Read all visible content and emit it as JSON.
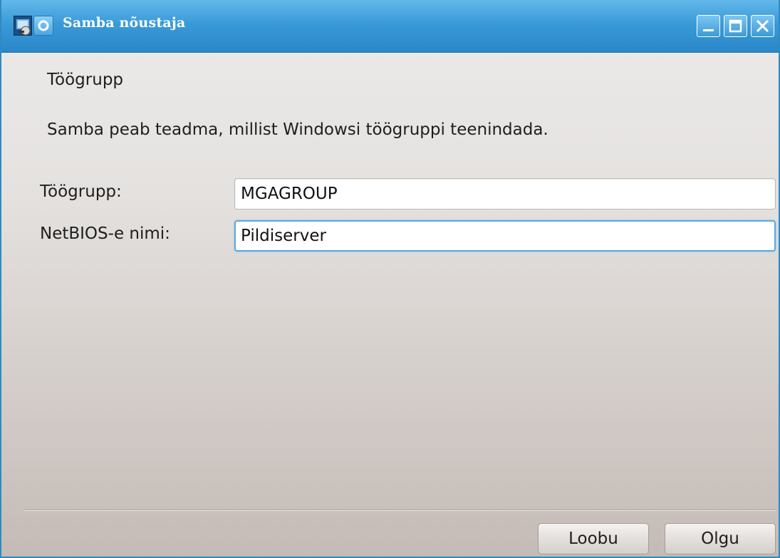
{
  "window": {
    "title": "Samba nõustaja",
    "accent_color": "#3a9ad8",
    "controls": {
      "minimize_icon": "minimize-icon",
      "maximize_icon": "maximize-icon",
      "close_icon": "close-icon"
    }
  },
  "page": {
    "heading": "Töögrupp",
    "description": "Samba peab teadma, millist Windowsi töögruppi teenindada."
  },
  "form": {
    "workgroup": {
      "label": "Töögrupp:",
      "value": "MGAGROUP"
    },
    "netbios": {
      "label": "NetBIOS-e nimi:",
      "value": "Pildiserver"
    }
  },
  "buttons": {
    "cancel_label": "Loobu",
    "ok_label": "Olgu"
  }
}
